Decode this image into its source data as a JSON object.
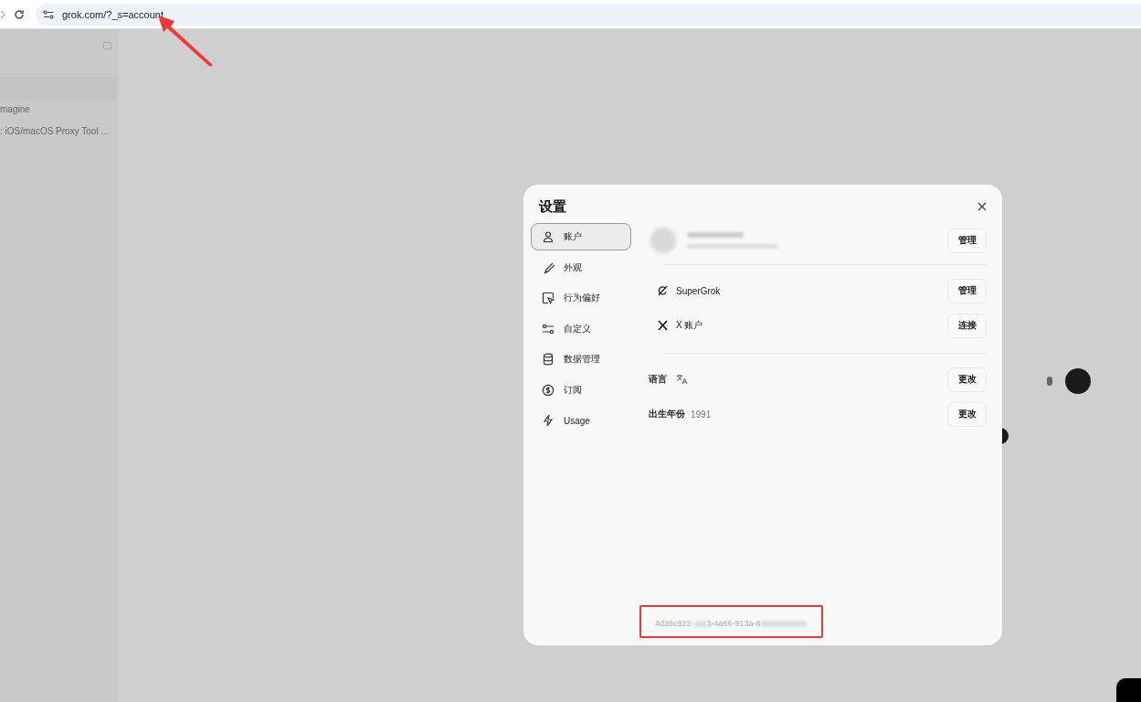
{
  "browser": {
    "url": "grok.com/?_s=account"
  },
  "sidebar": {
    "items": [
      {
        "label": "magine",
        "selected": false
      },
      {
        "label": ": iOS/macOS Proxy Tool ...",
        "selected": false
      }
    ]
  },
  "settings": {
    "title": "设置",
    "nav": [
      {
        "label": "账户",
        "selected": true
      },
      {
        "label": "外观",
        "selected": false
      },
      {
        "label": "行为偏好",
        "selected": false
      },
      {
        "label": "自定义",
        "selected": false
      },
      {
        "label": "数据管理",
        "selected": false
      },
      {
        "label": "订阅",
        "selected": false
      },
      {
        "label": "Usage",
        "selected": false
      }
    ],
    "account_button": "管理",
    "groups": [
      [
        {
          "label": "SuperGrok",
          "button": "管理"
        },
        {
          "label": "X 账户",
          "button": "连接"
        }
      ],
      [
        {
          "label": "语言",
          "button": "更改"
        },
        {
          "label": "出生年份",
          "value": "1991",
          "button": "更改"
        }
      ]
    ],
    "id_parts": [
      "4d26c922-",
      "3-4a66-913a-8"
    ]
  }
}
